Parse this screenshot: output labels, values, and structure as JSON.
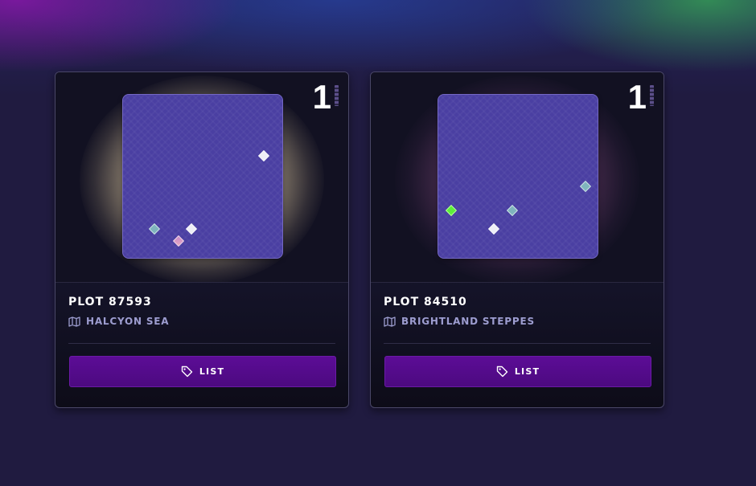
{
  "plots": [
    {
      "title": "PLOT 87593",
      "region": "HALCYON SEA",
      "badge": "1",
      "action_label": "LIST",
      "region_icon": "map-icon",
      "action_icon": "tag-icon",
      "glow_color": "#bfae91"
    },
    {
      "title": "PLOT 84510",
      "region": "BRIGHTLAND STEPPES",
      "badge": "1",
      "action_label": "LIST",
      "region_icon": "map-icon",
      "action_icon": "tag-icon",
      "glow_color": "#5f375f"
    }
  ],
  "colors": {
    "background": "#201b40",
    "plot_fill": "#4a3fa2",
    "button": "#5c0c96",
    "accent_text": "#9d9dd0",
    "marker_green": "#5cf03a"
  }
}
